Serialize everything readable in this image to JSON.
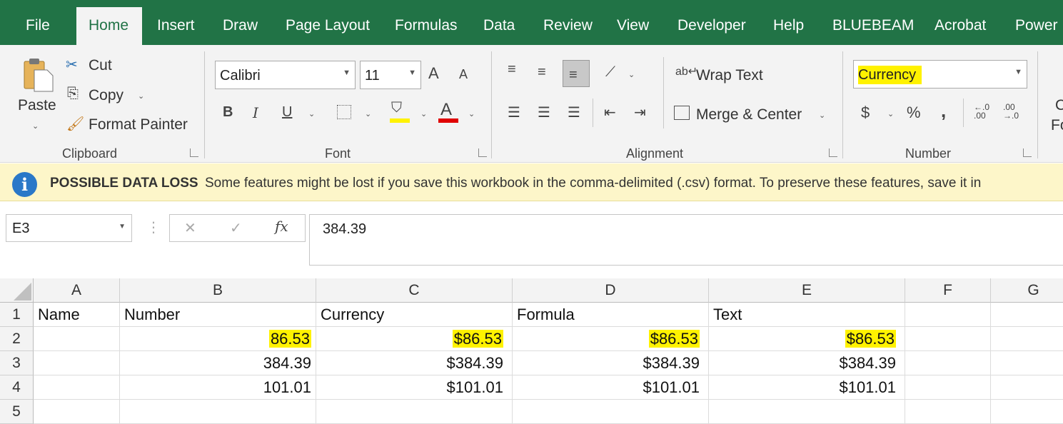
{
  "tabs": [
    "File",
    "Home",
    "Insert",
    "Draw",
    "Page Layout",
    "Formulas",
    "Data",
    "Review",
    "View",
    "Developer",
    "Help",
    "BLUEBEAM",
    "Acrobat",
    "Power P"
  ],
  "clipboard": {
    "paste": "Paste",
    "cut": "Cut",
    "copy": "Copy",
    "format_painter": "Format Painter",
    "group_label": "Clipboard"
  },
  "font": {
    "name": "Calibri",
    "size": "11",
    "bold": "B",
    "italic": "I",
    "underline": "U",
    "grow": "A",
    "shrink": "A",
    "fill_letter": "",
    "color_letter": "A",
    "group_label": "Font"
  },
  "alignment": {
    "wrap_text": "Wrap Text",
    "merge_center": "Merge & Center",
    "group_label": "Alignment"
  },
  "number": {
    "format": "Currency",
    "dollar": "$",
    "percent": "%",
    "comma": ",",
    "inc_decimal_top": "←.0",
    "inc_decimal_bottom": ".00",
    "dec_decimal_top": ".00",
    "dec_decimal_bottom": "→.0",
    "group_label": "Number"
  },
  "styles_partial": {
    "line1": "C",
    "line2": "Fo"
  },
  "infobar": {
    "title": "POSSIBLE DATA LOSS",
    "message": "Some features might be lost if you save this workbook in the comma-delimited (.csv) format. To preserve these features, save it in"
  },
  "formula_bar": {
    "name_box": "E3",
    "cancel": "✕",
    "enter": "✓",
    "fx": "fx",
    "value": "384.39"
  },
  "columns": [
    "A",
    "B",
    "C",
    "D",
    "E",
    "F",
    "G"
  ],
  "rows": [
    {
      "num": "1",
      "cells": [
        "Name",
        "Number",
        "Currency",
        "Formula",
        "Text",
        "",
        ""
      ]
    },
    {
      "num": "2",
      "cells": [
        "",
        "86.53",
        "$86.53",
        "$86.53",
        "$86.53",
        "",
        ""
      ]
    },
    {
      "num": "3",
      "cells": [
        "",
        "384.39",
        "$384.39",
        "$384.39",
        "$384.39",
        "",
        ""
      ]
    },
    {
      "num": "4",
      "cells": [
        "",
        "101.01",
        "$101.01",
        "$101.01",
        "$101.01",
        "",
        ""
      ]
    },
    {
      "num": "5",
      "cells": [
        "",
        "",
        "",
        "",
        "",
        "",
        ""
      ]
    }
  ],
  "colors": {
    "excel_green": "#217346",
    "highlight": "#fff200",
    "font_color_bar": "#e00000",
    "info_blue": "#2a78c8"
  }
}
